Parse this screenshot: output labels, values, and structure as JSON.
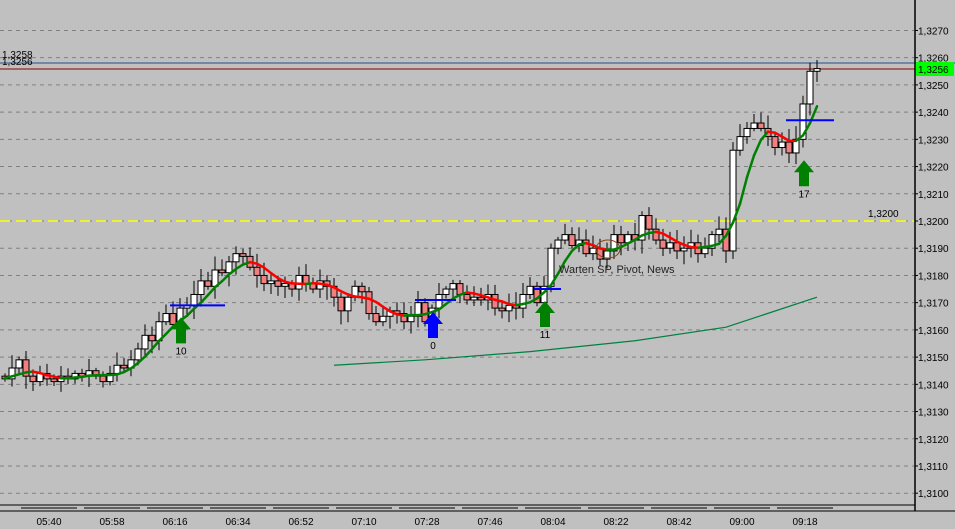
{
  "chart_data": {
    "type": "candlestick",
    "title": "",
    "ylim": [
      1.3095,
      1.3285
    ],
    "y_ticks": [
      "1,3270",
      "1,3260",
      "1,3250",
      "1,3240",
      "1,3230",
      "1,3220",
      "1,3210",
      "1,3200",
      "1,3190",
      "1,3180",
      "1,3170",
      "1,3160",
      "1,3150",
      "1,3140",
      "1,3130",
      "1,3120",
      "1,3110",
      "1,3100"
    ],
    "y_tick_values": [
      1.327,
      1.326,
      1.325,
      1.324,
      1.323,
      1.322,
      1.321,
      1.32,
      1.319,
      1.318,
      1.317,
      1.316,
      1.315,
      1.314,
      1.313,
      1.312,
      1.311,
      1.31
    ],
    "x_ticks": [
      "05:40",
      "05:58",
      "06:16",
      "06:34",
      "06:52",
      "07:10",
      "07:28",
      "07:46",
      "08:04",
      "08:22",
      "08:42",
      "09:00",
      "09:18"
    ],
    "x_tick_bar_index": [
      7,
      16,
      25,
      34,
      43,
      52,
      61,
      70,
      79,
      88,
      97,
      106,
      115
    ],
    "closes": [
      1.3142,
      1.3146,
      1.3149,
      1.3143,
      1.3141,
      1.3144,
      1.3142,
      1.3141,
      1.3143,
      1.3142,
      1.3144,
      1.3143,
      1.3145,
      1.3143,
      1.3141,
      1.3144,
      1.3147,
      1.3146,
      1.3149,
      1.3153,
      1.3158,
      1.3156,
      1.3163,
      1.3166,
      1.3162,
      1.3168,
      1.3169,
      1.3173,
      1.3178,
      1.3176,
      1.3182,
      1.3181,
      1.3185,
      1.3188,
      1.3187,
      1.3183,
      1.318,
      1.3177,
      1.3178,
      1.3176,
      1.3177,
      1.3175,
      1.318,
      1.3177,
      1.3175,
      1.3178,
      1.3176,
      1.3172,
      1.3167,
      1.3172,
      1.3176,
      1.3174,
      1.3166,
      1.3163,
      1.3165,
      1.3167,
      1.3166,
      1.3163,
      1.3165,
      1.317,
      1.3163,
      1.3168,
      1.3173,
      1.3175,
      1.3177,
      1.3173,
      1.3171,
      1.3172,
      1.3171,
      1.3173,
      1.3168,
      1.3167,
      1.3169,
      1.3168,
      1.3173,
      1.3176,
      1.317,
      1.3176,
      1.319,
      1.3193,
      1.3195,
      1.3191,
      1.3193,
      1.3188,
      1.319,
      1.3186,
      1.3189,
      1.3195,
      1.3192,
      1.3195,
      1.3193,
      1.3202,
      1.3197,
      1.3193,
      1.319,
      1.3192,
      1.3189,
      1.319,
      1.3192,
      1.3188,
      1.319,
      1.3195,
      1.3197,
      1.3189,
      1.3226,
      1.3231,
      1.3234,
      1.3236,
      1.3234,
      1.3231,
      1.3227,
      1.3229,
      1.3225,
      1.323,
      1.3243,
      1.3255,
      1.3256
    ],
    "slow_ma": [
      [
        47,
        1.3147
      ],
      [
        60,
        1.3149
      ],
      [
        75,
        1.3152
      ],
      [
        90,
        1.3156
      ],
      [
        103,
        1.3161
      ],
      [
        116,
        1.3172
      ]
    ],
    "signals": [
      {
        "bar": 25,
        "label": "10",
        "color": "#008000",
        "level": 1.3169,
        "level_from": 24,
        "level_to": 31
      },
      {
        "bar": 61,
        "label": "0",
        "color": "#0000ff",
        "level": 1.3171,
        "level_from": 59,
        "level_to": 64
      },
      {
        "bar": 77,
        "label": "11",
        "color": "#008000",
        "level": 1.3175,
        "level_from": 76,
        "level_to": 79
      },
      {
        "bar": 114,
        "label": "17",
        "color": "#008000",
        "level": 1.3237,
        "level_from": 112,
        "level_to": 118
      }
    ],
    "hline_level": {
      "value": 1.32,
      "label": "1,3200",
      "color": "#ffff00"
    },
    "ask_line": {
      "value": 1.3258,
      "label": "1,3258",
      "color": "#1f4e8c"
    },
    "bid_line": {
      "value": 1.3256,
      "label": "1,3256",
      "color": "#8b0000"
    },
    "current_price": {
      "label": "1,3256",
      "bg": "#00ff00",
      "fg": "#ff00ff"
    },
    "annotation": {
      "text": "Warten SP, Pivot, News",
      "bar": 79,
      "price": 1.3182
    }
  }
}
